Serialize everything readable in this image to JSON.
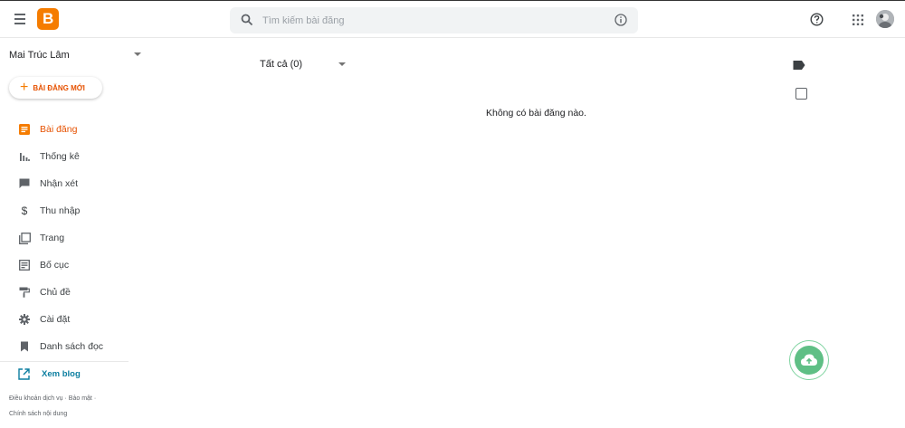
{
  "search": {
    "placeholder": "Tìm kiếm bài đăng"
  },
  "sidebar": {
    "blog_name": "Mai Trúc Lâm",
    "new_post_label": "BÀI ĐĂNG MỚI",
    "items": [
      {
        "label": "Bài đăng",
        "icon": "posts-icon",
        "active": true
      },
      {
        "label": "Thống kê",
        "icon": "stats-icon"
      },
      {
        "label": "Nhận xét",
        "icon": "comment-icon"
      },
      {
        "label": "Thu nhập",
        "icon": "dollar-icon"
      },
      {
        "label": "Trang",
        "icon": "pages-icon"
      },
      {
        "label": "Bố cục",
        "icon": "layout-icon"
      },
      {
        "label": "Chủ đề",
        "icon": "paint-roller-icon"
      },
      {
        "label": "Cài đặt",
        "icon": "gear-icon"
      },
      {
        "label": "Danh sách đọc",
        "icon": "bookmark-icon"
      }
    ],
    "view_blog_label": "Xem blog",
    "footer": {
      "terms": "Điều khoản dịch vụ",
      "privacy": "Bảo mật",
      "content_policy": "Chính sách nội dung",
      "separator": "·"
    }
  },
  "main": {
    "filter_label": "Tất cả (0)",
    "empty_message": "Không có bài đăng nào."
  },
  "colors": {
    "accent": "#f57c00",
    "active_text": "#e65100",
    "link": "#0b7ea0",
    "fab": "#5fbf85"
  }
}
